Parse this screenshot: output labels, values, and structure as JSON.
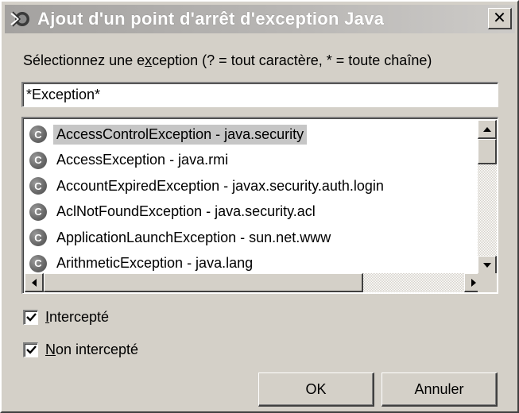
{
  "window": {
    "title": "Ajout d'un point d'arrêt d'exception Java",
    "close_glyph": "✕",
    "title_icon": "breakpoint-icon"
  },
  "prompt": {
    "before": "Sélectionnez une e",
    "mnemonic": "x",
    "after": "ception (? = tout caractère, * = toute chaîne)"
  },
  "filter": {
    "value": "*Exception*",
    "placeholder": ""
  },
  "list": {
    "item_icon": "class-icon",
    "item_icon_glyph": "C",
    "selected_index": 0,
    "items": [
      {
        "label": "AccessControlException - java.security"
      },
      {
        "label": "AccessException - java.rmi"
      },
      {
        "label": "AccountExpiredException - javax.security.auth.login"
      },
      {
        "label": "AclNotFoundException - java.security.acl"
      },
      {
        "label": "ApplicationLaunchException - sun.net.www"
      },
      {
        "label": "ArithmeticException - java.lang"
      }
    ]
  },
  "options": {
    "caught": {
      "mnemonic": "I",
      "rest": "ntercepté",
      "checked": true
    },
    "uncaught": {
      "mnemonic": "N",
      "rest": "on intercepté",
      "checked": true
    }
  },
  "buttons": {
    "ok": "OK",
    "cancel": "Annuler"
  },
  "colors": {
    "dialog_bg": "#d4d0c8",
    "selection_bg": "#c6c6c6",
    "titlebar_text": "#ffffff"
  }
}
